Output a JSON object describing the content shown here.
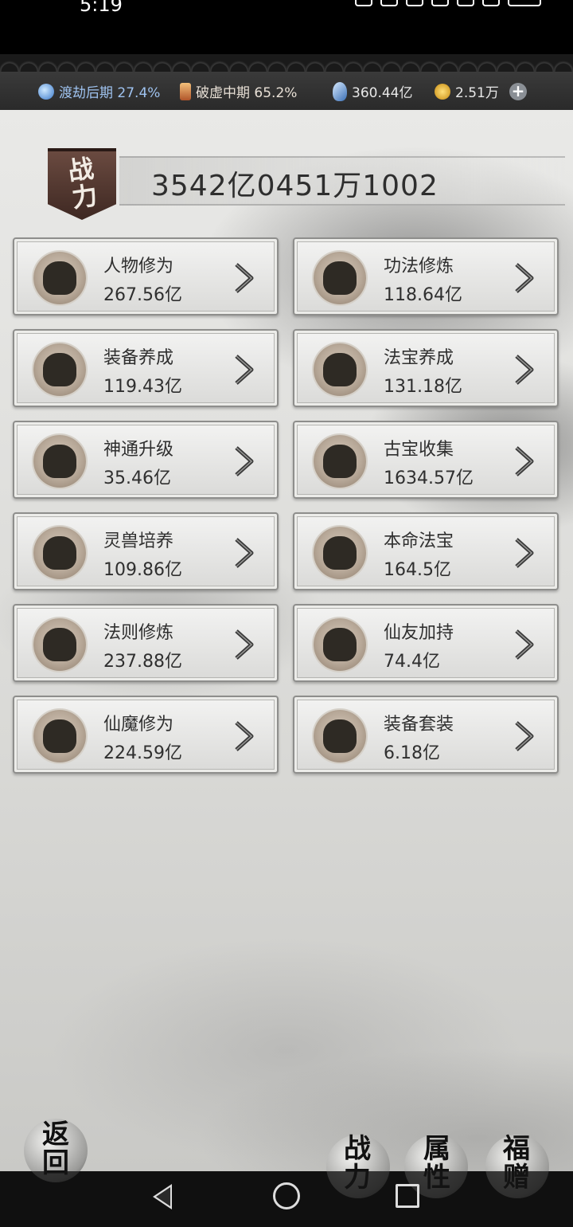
{
  "status_bar": {
    "time": "5:19"
  },
  "resources": {
    "realm1": "渡劫后期 27.4%",
    "realm2": "破虚中期 65.2%",
    "crystals": "360.44亿",
    "gold": "2.51万"
  },
  "power": {
    "flag_label": "战力",
    "value": "3542亿0451万1002"
  },
  "cards": [
    {
      "label": "人物修为",
      "value": "267.56亿",
      "icon": "figure-silhouette-icon"
    },
    {
      "label": "功法修炼",
      "value": "118.64亿",
      "icon": "scroll-icon"
    },
    {
      "label": "装备养成",
      "value": "119.43亿",
      "icon": "sword-icon"
    },
    {
      "label": "法宝养成",
      "value": "131.18亿",
      "icon": "gourd-icon"
    },
    {
      "label": "神通升级",
      "value": "35.46亿",
      "icon": "bell-icon"
    },
    {
      "label": "古宝收集",
      "value": "1634.57亿",
      "icon": "ancient-bell-icon"
    },
    {
      "label": "灵兽培养",
      "value": "109.86亿",
      "icon": "beast-icon"
    },
    {
      "label": "本命法宝",
      "value": "164.5亿",
      "icon": "gourd-icon"
    },
    {
      "label": "法则修炼",
      "value": "237.88亿",
      "icon": "scroll-icon"
    },
    {
      "label": "仙友加持",
      "value": "74.4亿",
      "icon": "companions-icon"
    },
    {
      "label": "仙魔修为",
      "value": "224.59亿",
      "icon": "immortal-demon-icon"
    },
    {
      "label": "装备套装",
      "value": "6.18亿",
      "icon": "gourd-icon"
    }
  ],
  "bottom": {
    "back": "返回",
    "tab_power": "战力",
    "tab_attributes": "属性",
    "tab_gifts": "福赠"
  }
}
